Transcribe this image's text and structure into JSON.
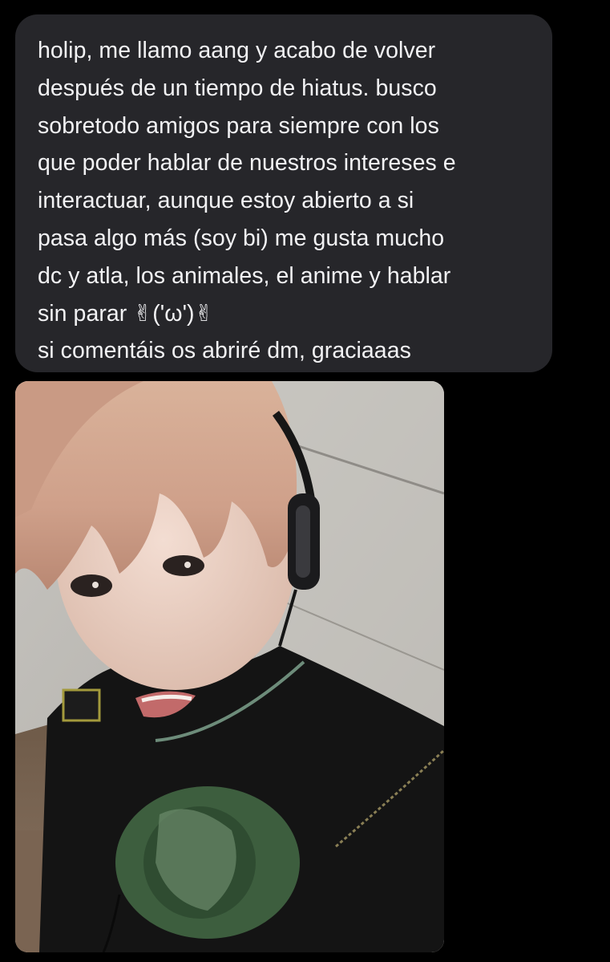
{
  "message": {
    "lines": [
      "holip, me llamo aang y acabo de volver",
      "después de un tiempo de hiatus. busco",
      "sobretodo amigos para siempre con los",
      "que poder hablar de nuestros intereses e",
      "interactuar, aunque estoy abierto a si",
      "pasa algo más (soy bi) me gusta mucho",
      "dc y atla, los animales, el anime y hablar",
      "sin parar ✌︎('ω')✌︎",
      "si comentáis os abriré dm, graciaaas"
    ],
    "bubble_color": "#26262a",
    "text_color": "#f2f2f4"
  },
  "attachment": {
    "type": "photo",
    "subject": "selfie"
  },
  "colors": {
    "background": "#000000"
  }
}
